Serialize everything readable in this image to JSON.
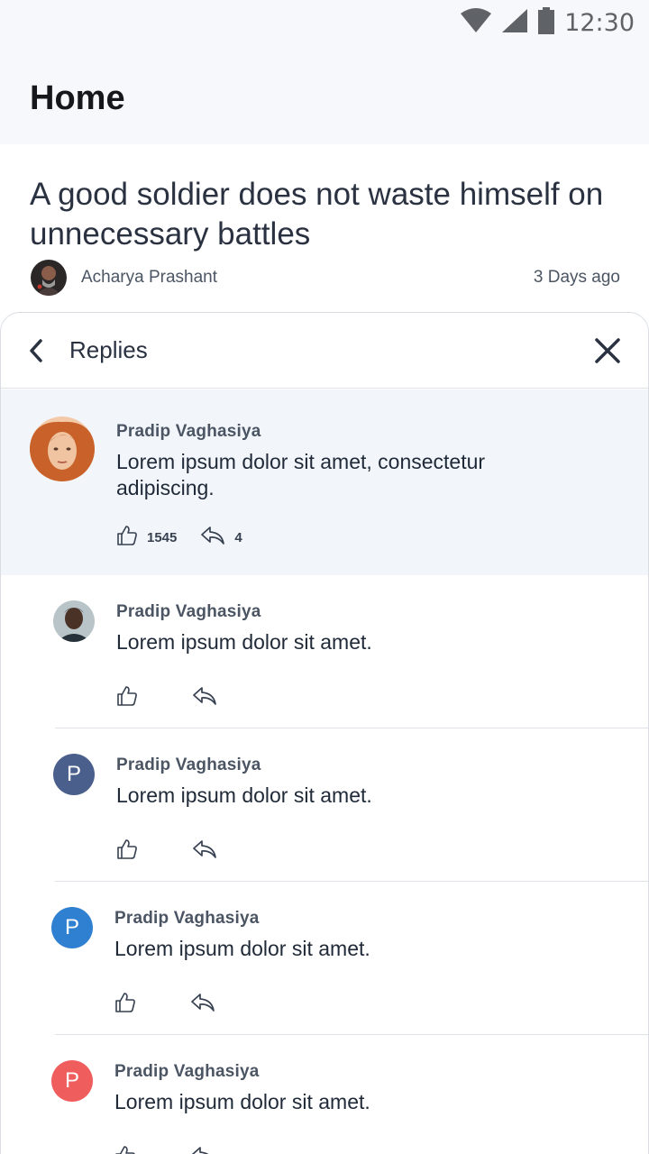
{
  "status_bar": {
    "time": "12:30",
    "icons": [
      "wifi-icon",
      "signal-icon",
      "battery-icon"
    ]
  },
  "header": {
    "title": "Home"
  },
  "post": {
    "title": "A good soldier does not waste himself on unnecessary battles",
    "author": "Acharya Prashant",
    "time": "3 Days ago"
  },
  "replies_sheet": {
    "title": "Replies",
    "parent_comment": {
      "name": "Pradip Vaghasiya",
      "text": "Lorem ipsum dolor sit amet, consectetur adipiscing.",
      "likes": "1545",
      "replies": "4"
    },
    "replies": [
      {
        "name": "Pradip Vaghasiya",
        "text": "Lorem ipsum dolor sit amet.",
        "avatar_type": "photo",
        "initial": ""
      },
      {
        "name": "Pradip Vaghasiya",
        "text": "Lorem ipsum dolor sit amet.",
        "avatar_type": "initial",
        "initial": "P",
        "color": "#4a5f8c"
      },
      {
        "name": "Pradip Vaghasiya",
        "text": "Lorem ipsum dolor sit amet.",
        "avatar_type": "initial",
        "initial": "P",
        "color": "#2f80d0"
      },
      {
        "name": "Pradip Vaghasiya",
        "text": "Lorem ipsum dolor sit amet.",
        "avatar_type": "initial",
        "initial": "P",
        "color": "#ef5d5d"
      }
    ]
  },
  "colors": {
    "parent_bg": "#f2f6fb",
    "topbar_bg": "#f6f8fb",
    "divider": "#dfe3e8"
  }
}
